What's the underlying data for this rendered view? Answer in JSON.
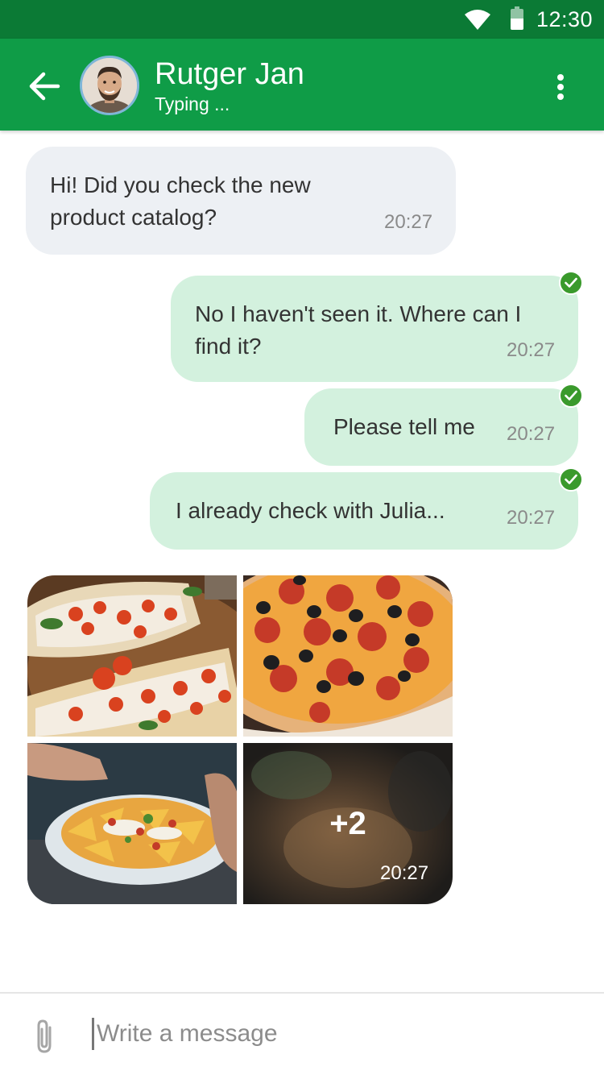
{
  "status_bar": {
    "time": "12:30",
    "wifi_icon": "wifi-icon",
    "battery_icon": "battery-icon"
  },
  "header": {
    "back_icon": "arrow-left-icon",
    "contact_name": "Rutger Jan",
    "contact_status": "Typing ...",
    "menu_icon": "more-vertical-icon"
  },
  "messages": [
    {
      "direction": "incoming",
      "text": "Hi! Did you check the new product catalog?",
      "time": "20:27"
    },
    {
      "direction": "outgoing",
      "text": "No I haven't seen it. Where can I find it?",
      "time": "20:27",
      "read_icon": "check-circle-icon"
    },
    {
      "direction": "outgoing",
      "text": "Please tell me",
      "time": "20:27",
      "read_icon": "check-circle-icon"
    },
    {
      "direction": "outgoing",
      "text": "I already check with Julia...",
      "time": "20:27",
      "read_icon": "check-circle-icon"
    }
  ],
  "gallery": {
    "direction": "incoming",
    "photos": [
      "bruschetta-photo",
      "pepperoni-pizza-photo",
      "nachos-photo",
      "blurred-food-photo"
    ],
    "more_count": "+2",
    "time": "20:27"
  },
  "composer": {
    "attach_icon": "paperclip-icon",
    "placeholder": "Write a message"
  },
  "colors": {
    "status_bar": "#0b7a35",
    "app_bar": "#0f9c47",
    "incoming_bubble": "#edf0f4",
    "outgoing_bubble": "#d3f1de",
    "read_check": "#3a9a2c"
  }
}
